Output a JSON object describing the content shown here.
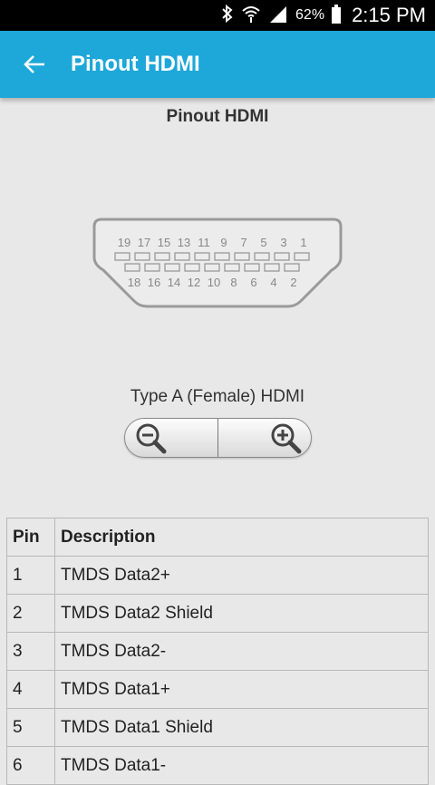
{
  "status_bar": {
    "battery_percent": "62%",
    "time": "2:15 PM",
    "icons": [
      "bluetooth-icon",
      "wifi-icon",
      "signal-icon",
      "battery-icon"
    ]
  },
  "app_bar": {
    "title": "Pinout HDMI",
    "back_icon": "arrow-back-icon",
    "color": "#1ea7d9"
  },
  "page": {
    "title": "Pinout HDMI",
    "connector": {
      "top_pins": [
        "19",
        "17",
        "15",
        "13",
        "11",
        "9",
        "7",
        "5",
        "3",
        "1"
      ],
      "bottom_pins": [
        "18",
        "16",
        "14",
        "12",
        "10",
        "8",
        "6",
        "4",
        "2"
      ]
    },
    "caption": "Type A (Female) HDMI",
    "zoom": {
      "out_icon": "zoom-out-icon",
      "in_icon": "zoom-in-icon"
    }
  },
  "table": {
    "headers": [
      "Pin",
      "Description"
    ],
    "rows": [
      [
        "1",
        "TMDS Data2+"
      ],
      [
        "2",
        "TMDS Data2 Shield"
      ],
      [
        "3",
        "TMDS Data2-"
      ],
      [
        "4",
        "TMDS Data1+"
      ],
      [
        "5",
        "TMDS Data1 Shield"
      ],
      [
        "6",
        "TMDS Data1-"
      ]
    ]
  }
}
